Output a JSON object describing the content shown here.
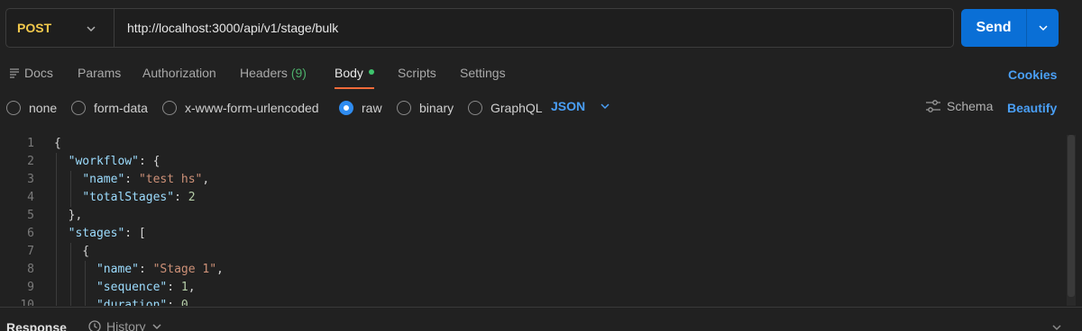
{
  "request": {
    "method": "POST",
    "url": "http://localhost:3000/api/v1/stage/bulk",
    "send_label": "Send"
  },
  "tabs": [
    {
      "label": "Docs"
    },
    {
      "label": "Params"
    },
    {
      "label": "Authorization"
    },
    {
      "label": "Headers",
      "count": "(9)"
    },
    {
      "label": "Body"
    },
    {
      "label": "Scripts"
    },
    {
      "label": "Settings"
    }
  ],
  "cookies_label": "Cookies",
  "body_types": [
    "none",
    "form-data",
    "x-www-form-urlencoded",
    "raw",
    "binary",
    "GraphQL"
  ],
  "selected_body_type": "raw",
  "format": "JSON",
  "schema_label": "Schema",
  "beautify_label": "Beautify",
  "editor_lines": [
    {
      "n": "1",
      "code": "{"
    },
    {
      "n": "2",
      "code": "  \"workflow\": {"
    },
    {
      "n": "3",
      "code": "    \"name\": \"test hs\","
    },
    {
      "n": "4",
      "code": "    \"totalStages\": 2"
    },
    {
      "n": "5",
      "code": "  },"
    },
    {
      "n": "6",
      "code": "  \"stages\": ["
    },
    {
      "n": "7",
      "code": "    {"
    },
    {
      "n": "8",
      "code": "      \"name\": \"Stage 1\","
    },
    {
      "n": "9",
      "code": "      \"sequence\": 1,"
    },
    {
      "n": "10",
      "code": "      \"duration\": 0,"
    }
  ],
  "response": {
    "label": "Response",
    "history_label": "History"
  },
  "colors": {
    "accent": "#0a6fd6",
    "method": "#f2c94c",
    "active_tab": "#f26b3a",
    "link": "#4a9ff5"
  }
}
